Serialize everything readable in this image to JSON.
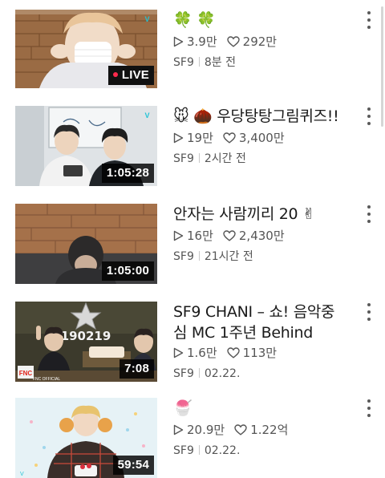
{
  "videos": [
    {
      "title": "🍀 🍀",
      "plays": "3.9만",
      "likes": "292만",
      "channel": "SF9",
      "time": "8분 전",
      "badge": "LIVE",
      "is_live": true
    },
    {
      "title": "🐭 🌰 우당탕탕그림퀴즈!!",
      "plays": "19만",
      "likes": "3,400만",
      "channel": "SF9",
      "time": "2시간 전",
      "badge": "1:05:28",
      "is_live": false
    },
    {
      "title": "안자는 사람끼리 20 ✌",
      "plays": "16만",
      "likes": "2,430만",
      "channel": "SF9",
      "time": "21시간 전",
      "badge": "1:05:00",
      "is_live": false
    },
    {
      "title": "SF9 CHANI – 쇼! 음악중심 MC 1주년 Behind",
      "plays": "1.6만",
      "likes": "113만",
      "channel": "SF9",
      "time": "02.22.",
      "badge": "7:08",
      "is_live": false,
      "thumb_text": "190219",
      "logo_text": "FNC OFFICIAL"
    },
    {
      "title": "🍧",
      "plays": "20.9만",
      "likes": "1.22억",
      "channel": "SF9",
      "time": "02.22.",
      "badge": "59:54",
      "is_live": false
    }
  ],
  "icons": {
    "play": "play-count-icon",
    "heart": "heart-icon",
    "more": "more-options-icon",
    "vlive": "vlive-logo-icon"
  },
  "colors": {
    "live_dot": "#ff2a4d",
    "vlive": "#22c3d5",
    "text": "#1a1a1a",
    "meta": "#555555"
  }
}
